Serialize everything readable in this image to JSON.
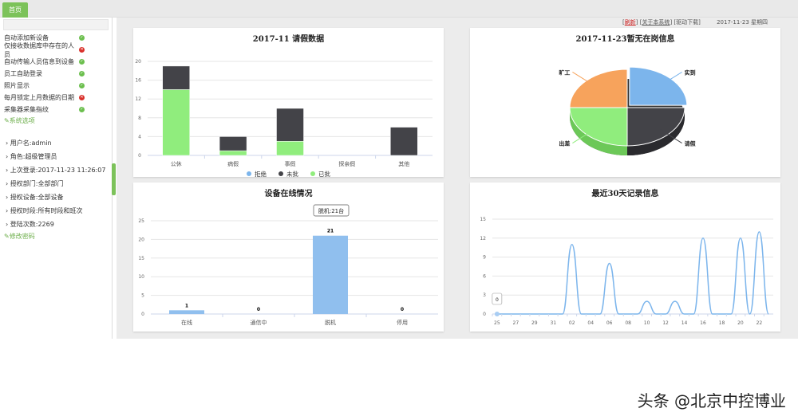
{
  "tab": "首页",
  "sidebar": {
    "options": [
      {
        "label": "自动添加新设备",
        "on": true
      },
      {
        "label": "仅接收数据库中存在的人员",
        "on": false
      },
      {
        "label": "自动传输人员信息到设备",
        "on": true
      },
      {
        "label": "员工自助登录",
        "on": true
      },
      {
        "label": "照片显示",
        "on": true
      },
      {
        "label": "每月锁定上月数据的日期",
        "on": false
      },
      {
        "label": "采集器采集指纹",
        "on": true
      }
    ],
    "system_options_link": "系统选项",
    "info": [
      "用户名:admin",
      "角色:超级管理员",
      "上次登录:2017-11-23 11:26:07",
      "授权部门:全部部门",
      "授权设备:全部设备",
      "授权时段:所有时段和班次",
      "登陆次数:2269"
    ],
    "change_password_link": "修改密码"
  },
  "toplinks": {
    "refresh": "刷新",
    "about": "关于本系统",
    "driver": "驱动下载",
    "date": "2017-11-23 星期四"
  },
  "watermark": "头条 @北京中控博业",
  "chart_data": [
    {
      "type": "bar",
      "title": "2017-11 请假数据",
      "categories": [
        "公休",
        "病假",
        "事假",
        "探亲假",
        "其他"
      ],
      "ylim": [
        0,
        20
      ],
      "yticks": [
        0,
        4,
        8,
        12,
        16,
        20
      ],
      "stacked": true,
      "series": [
        {
          "name": "拒绝",
          "color": "#7cb5ec",
          "values": [
            0,
            0,
            0,
            0,
            0
          ]
        },
        {
          "name": "未批",
          "color": "#434348",
          "values": [
            5,
            3,
            7,
            0,
            6
          ]
        },
        {
          "name": "已批",
          "color": "#90ed7d",
          "values": [
            14,
            1,
            3,
            0,
            0
          ]
        }
      ]
    },
    {
      "type": "pie",
      "title": "2017-11-23暂无在岗信息",
      "slices": [
        {
          "name": "实到",
          "value": 25,
          "color": "#7cb5ec"
        },
        {
          "name": "请假",
          "value": 25,
          "color": "#434348"
        },
        {
          "name": "出差",
          "value": 25,
          "color": "#90ed7d"
        },
        {
          "name": "旷工",
          "value": 25,
          "color": "#f7a35c"
        }
      ]
    },
    {
      "type": "bar",
      "title": "设备在线情况",
      "categories": [
        "在线",
        "通信中",
        "脱机",
        "停用"
      ],
      "values": [
        1,
        0,
        21,
        0
      ],
      "ylim": [
        0,
        25
      ],
      "yticks": [
        0,
        5,
        10,
        15,
        20,
        25
      ],
      "color": "#90bfee",
      "tooltip": "脱机:21台"
    },
    {
      "type": "line",
      "title": "最近30天记录信息",
      "x": [
        "25",
        "26",
        "27",
        "28",
        "29",
        "30",
        "31",
        "01",
        "02",
        "03",
        "04",
        "05",
        "06",
        "07",
        "08",
        "09",
        "10",
        "11",
        "12",
        "13",
        "14",
        "15",
        "16",
        "17",
        "18",
        "19",
        "20",
        "21",
        "22",
        "23"
      ],
      "xticks": [
        "25",
        "27",
        "29",
        "31",
        "02",
        "04",
        "06",
        "08",
        "10",
        "12",
        "14",
        "16",
        "18",
        "20",
        "22"
      ],
      "values": [
        0,
        0,
        0,
        0,
        0,
        0,
        0,
        0,
        11,
        0,
        0,
        0,
        8,
        0,
        0,
        0,
        2,
        0,
        0,
        2,
        0,
        0,
        12,
        0,
        0,
        0,
        12,
        0,
        13,
        0
      ],
      "ylim": [
        0,
        15
      ],
      "yticks": [
        0,
        3,
        6,
        9,
        12,
        15
      ],
      "color": "#7cb5ec",
      "tooltip": "0"
    }
  ]
}
